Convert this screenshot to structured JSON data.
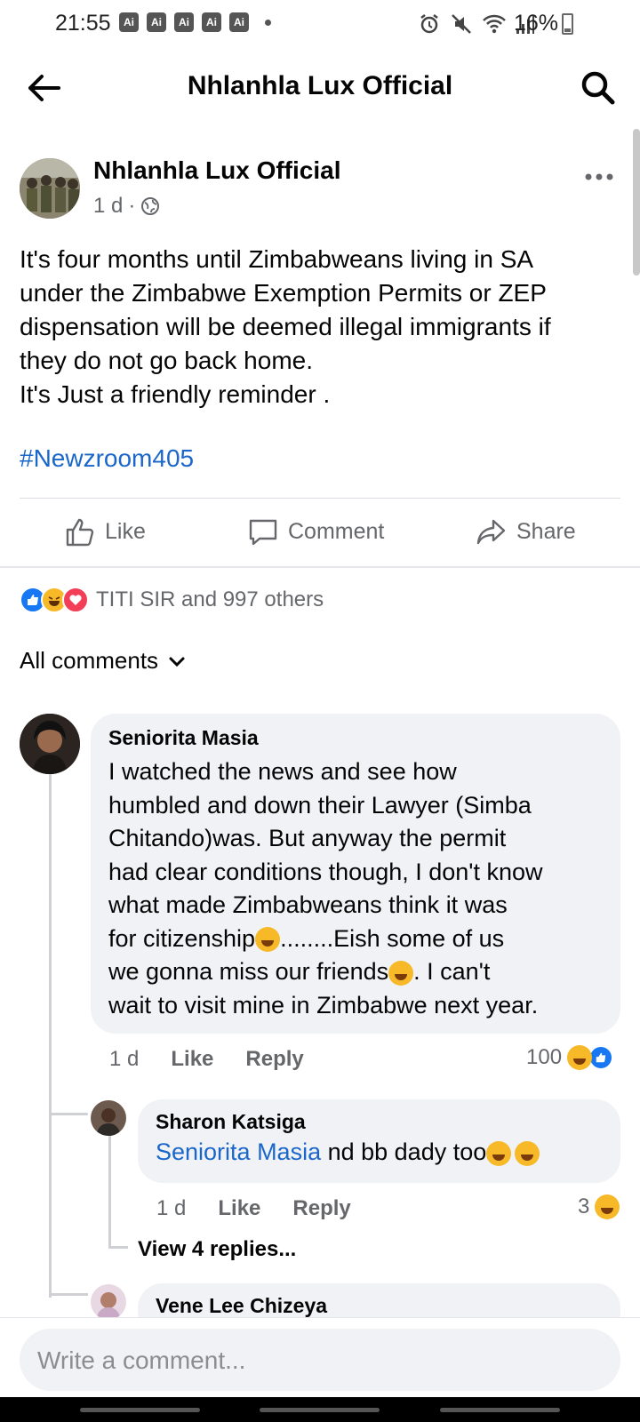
{
  "status_bar": {
    "time": "21:55",
    "ai_badges": [
      "Ai",
      "Ai",
      "Ai",
      "Ai",
      "Ai"
    ],
    "battery": "16%",
    "icons": [
      "alarm-icon",
      "mute-icon",
      "wifi-icon",
      "signal-icon",
      "battery-icon"
    ]
  },
  "header": {
    "title": "Nhlanhla Lux Official"
  },
  "post": {
    "author": "Nhlanhla Lux Official",
    "time": "1 d",
    "separator": "·",
    "lines": [
      "It's four months until Zimbabweans living in SA",
      "under the Zimbabwe Exemption Permits or ZEP",
      "dispensation will be deemed illegal immigrants if",
      "they do not go back home.",
      "It's Just a friendly reminder ."
    ],
    "hashtag": "#Newzroom405",
    "actions": {
      "like": "Like",
      "comment": "Comment",
      "share": "Share"
    },
    "reactions_text": "TITI SIR and 997 others"
  },
  "comments_filter": "All comments",
  "comments": [
    {
      "name": "Seniorita Masia",
      "lines": [
        "I watched the news and see how",
        "humbled and down their Lawyer (Simba",
        "Chitando)was. But anyway the permit",
        "had clear conditions though, I don't know",
        "what made Zimbabweans think it was",
        "for citizenship",
        "........Eish some of us",
        "we gonna miss our friends",
        ". I can't",
        "wait to visit mine in Zimbabwe next year."
      ],
      "time": "1 d",
      "like": "Like",
      "reply": "Reply",
      "reaction_count": "100"
    },
    {
      "name": "Sharon Katsiga",
      "mention": "Seniorita Masia",
      "text": " nd bb dady too",
      "time": "1 d",
      "like": "Like",
      "reply": "Reply",
      "reaction_count": "3",
      "view_replies": "View 4 replies..."
    },
    {
      "name": "Vene Lee Chizeya"
    }
  ],
  "composer": {
    "placeholder": "Write a comment..."
  },
  "colors": {
    "link": "#1b66c9",
    "bubble": "#f0f2f5",
    "secondary_text": "#65676b",
    "like_blue": "#1877f2",
    "love_red": "#f33e58",
    "haha_yellow": "#f7b928"
  }
}
